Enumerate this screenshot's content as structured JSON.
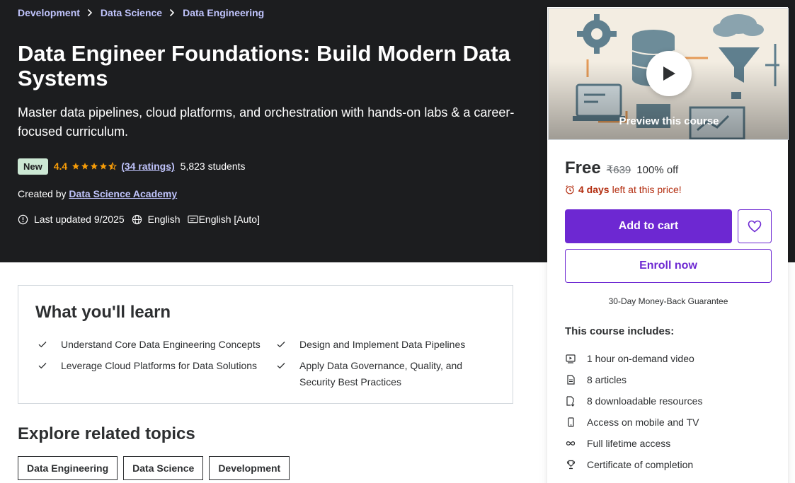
{
  "breadcrumb": [
    "Development",
    "Data Science",
    "Data Engineering"
  ],
  "course": {
    "title": "Data Engineer Foundations: Build Modern Data Systems",
    "subtitle": "Master data pipelines, cloud platforms, and orchestration with hands-on labs & a career-focused curriculum.",
    "badge": "New",
    "rating": "4.4",
    "rating_value": 4.4,
    "ratings_count": "(34 ratings)",
    "students": "5,823 students",
    "created_by_label": "Created by",
    "author": "Data Science Academy",
    "last_updated": "Last updated 9/2025",
    "language": "English",
    "captions": "English [Auto]"
  },
  "learn": {
    "title": "What you'll learn",
    "items": [
      "Understand Core Data Engineering Concepts",
      "Design and Implement Data Pipelines",
      "Leverage Cloud Platforms for Data Solutions",
      "Apply Data Governance, Quality, and Security Best Practices"
    ]
  },
  "explore": {
    "title": "Explore related topics",
    "topics": [
      "Data Engineering",
      "Data Science",
      "Development"
    ]
  },
  "sidebar": {
    "preview_label": "Preview this course",
    "price": "Free",
    "original_price": "₹639",
    "discount": "100% off",
    "timer_bold": "4 days",
    "timer_rest": "left at this price!",
    "add_to_cart": "Add to cart",
    "enroll": "Enroll now",
    "guarantee": "30-Day Money-Back Guarantee",
    "includes_title": "This course includes:",
    "includes": [
      {
        "icon": "video-icon",
        "label": "1 hour on-demand video"
      },
      {
        "icon": "article-icon",
        "label": "8 articles"
      },
      {
        "icon": "download-icon",
        "label": "8 downloadable resources"
      },
      {
        "icon": "mobile-icon",
        "label": "Access on mobile and TV"
      },
      {
        "icon": "infinity-icon",
        "label": "Full lifetime access"
      },
      {
        "icon": "trophy-icon",
        "label": "Certificate of completion"
      }
    ]
  },
  "colors": {
    "hero_bg": "#1c1d1f",
    "link": "#c0c4fc",
    "star": "#f69c08",
    "primary": "#6d28d2",
    "timer": "#b32d0f"
  }
}
